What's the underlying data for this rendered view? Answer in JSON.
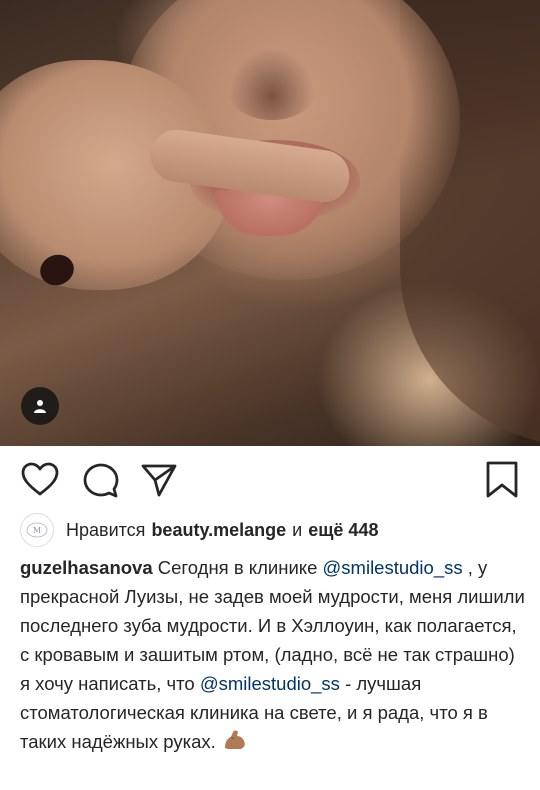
{
  "post": {
    "tag_icon": "user-tag-icon"
  },
  "actions": {
    "like_icon": "heart-icon",
    "comment_icon": "comment-icon",
    "share_icon": "send-icon",
    "save_icon": "bookmark-icon"
  },
  "likes": {
    "prefix": "Нравится",
    "user": "beauty.melange",
    "conj": "и",
    "others": "ещё 448"
  },
  "caption": {
    "username": "guzelhasanova",
    "text_1": "Сегодня в клинике",
    "mention_1": "@smilestudio_ss",
    "text_2": ", у прекрасной Луизы, не задев моей мудрости, меня лишили последнего зуба мудрости. И в Хэллоуин, как полагается, с кровавым и зашитым ртом, (ладно, всё не так страшно) я хочу написать, что",
    "mention_2": "@smilestudio_ss",
    "text_3": "- лучшая стоматологическая клиника на свете, и я рада, что я в таких надёжных руках.",
    "emoji": "flexed-biceps-emoji"
  }
}
